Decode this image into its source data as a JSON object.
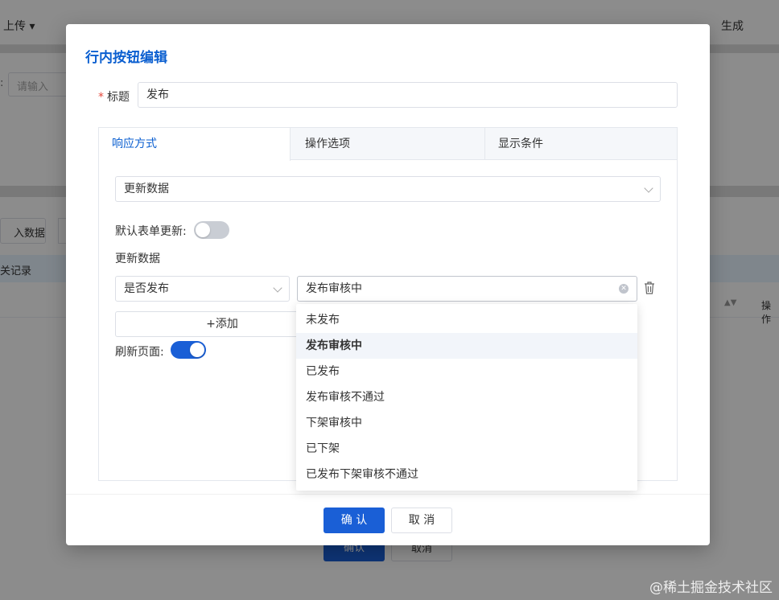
{
  "background": {
    "toolbar": {
      "upload_label": "上传 ▾",
      "generate_label": "生成"
    },
    "search": {
      "placeholder": "请输入",
      "colon": ":"
    },
    "import_label": "入数据",
    "records_label": "关记录",
    "ops_label": "操作",
    "confirm_label": "确认",
    "cancel_label": "取消"
  },
  "dialog": {
    "title": "行内按钮编辑",
    "title_field": {
      "required_mark": "*",
      "label": "标题",
      "value": "发布"
    },
    "tabs": [
      {
        "label": "响应方式",
        "active": true
      },
      {
        "label": "操作选项",
        "active": false
      },
      {
        "label": "显示条件",
        "active": false
      }
    ],
    "response_type": {
      "value": "更新数据"
    },
    "default_form_update": {
      "label": "默认表单更新:",
      "on": false
    },
    "update_data": {
      "label": "更新数据",
      "field": "是否发布",
      "value": "发布审核中",
      "add_label": "+添加"
    },
    "refresh_page": {
      "label": "刷新页面:",
      "on": true
    },
    "footer": {
      "confirm_label": "确 认",
      "cancel_label": "取 消"
    }
  },
  "dropdown": {
    "options": [
      {
        "label": "未发布",
        "selected": false
      },
      {
        "label": "发布审核中",
        "selected": true
      },
      {
        "label": "已发布",
        "selected": false
      },
      {
        "label": "发布审核不通过",
        "selected": false
      },
      {
        "label": "下架审核中",
        "selected": false
      },
      {
        "label": "已下架",
        "selected": false
      },
      {
        "label": "已发布下架审核不通过",
        "selected": false
      }
    ]
  },
  "watermark": "@稀土掘金技术社区",
  "colors": {
    "primary": "#1a5fd6",
    "title_blue": "#0b5fd0",
    "required": "#e5483b"
  }
}
